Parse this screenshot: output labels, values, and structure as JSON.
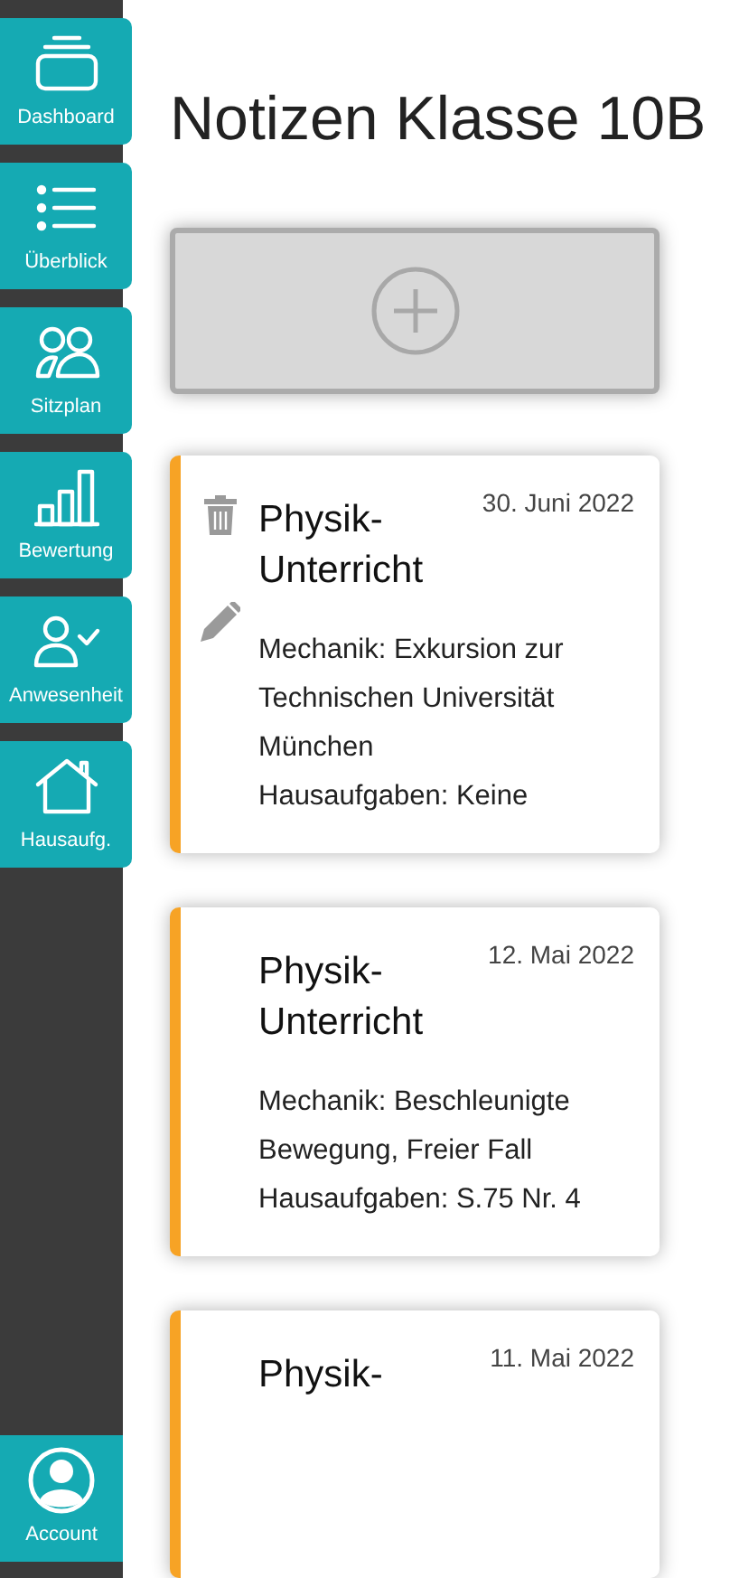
{
  "sidebar": {
    "items": [
      {
        "kind": "dashboard",
        "label": "Dashboard"
      },
      {
        "kind": "list",
        "label": "Überblick"
      },
      {
        "kind": "people",
        "label": "Sitzplan"
      },
      {
        "kind": "chart",
        "label": "Bewertung"
      },
      {
        "kind": "attendance",
        "label": "Anwesenheit"
      },
      {
        "kind": "home",
        "label": "Hausaufg."
      }
    ],
    "account": {
      "label": "Account"
    }
  },
  "title": "Notizen Klasse 10B",
  "notes": [
    {
      "title": "Physik-Unterricht",
      "date": "30. Juni 2022",
      "actions_visible": true,
      "lines": [
        "Mechanik: Exkursion zur Technischen Universität München",
        "Hausaufgaben: Keine"
      ]
    },
    {
      "title": "Physik-Unterricht",
      "date": "12. Mai 2022",
      "actions_visible": false,
      "lines": [
        "Mechanik: Beschleunigte Bewegung, Freier Fall",
        "Hausaufgaben: S.75 Nr. 4"
      ]
    },
    {
      "title": "Physik-",
      "date": "11. Mai 2022",
      "actions_visible": false
    }
  ]
}
